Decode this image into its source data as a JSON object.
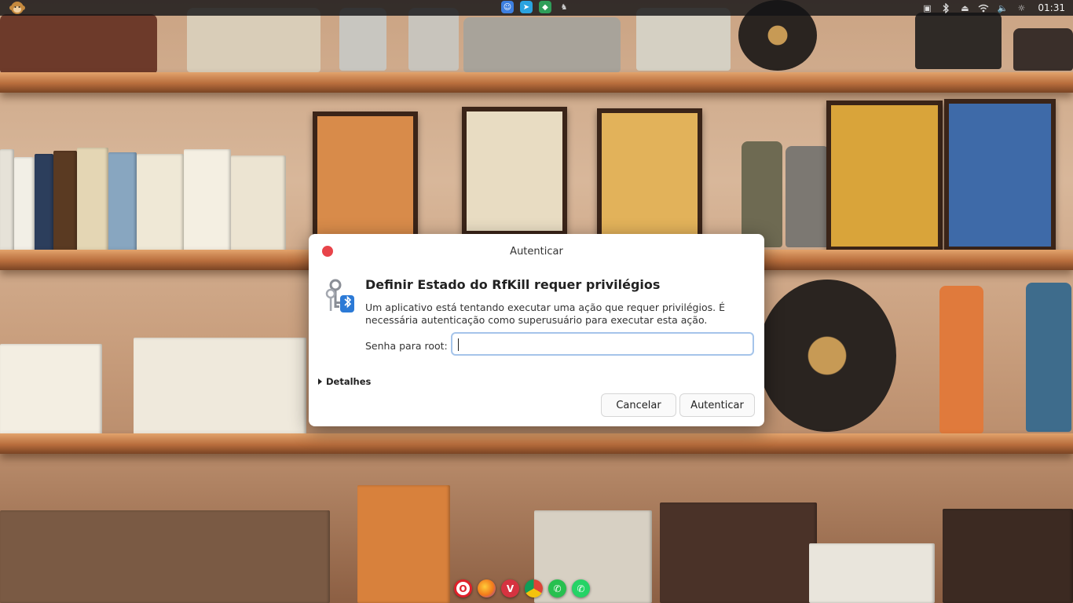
{
  "panel": {
    "clock": "01:31",
    "center_apps": [
      {
        "icon": "finder-face-icon",
        "color": "#3d7fe0"
      },
      {
        "icon": "telegram-icon",
        "color": "#2aa3e0"
      },
      {
        "icon": "shield-vpn-icon",
        "color": "#2f9e59"
      },
      {
        "icon": "ghost-icon",
        "color": "#7a7a7a"
      }
    ]
  },
  "dialog": {
    "title": "Autenticar",
    "heading": "Definir Estado do RfKill requer privilégios",
    "message": "Um aplicativo está tentando executar uma ação que requer privilégios. É necessária autenticação como superusuário para executar esta ação.",
    "password_label": "Senha para root:",
    "password_value": "",
    "details_label": "Detalhes",
    "cancel_label": "Cancelar",
    "authenticate_label": "Autenticar",
    "accent_color": "#a5c4ea",
    "close_color": "#e8444a"
  },
  "dock": {
    "apps": [
      {
        "icon": "opera-icon",
        "glyph": "O",
        "color": "#e0202a"
      },
      {
        "icon": "firefox-icon",
        "glyph": "",
        "color": "#f27a1a"
      },
      {
        "icon": "vivaldi-icon",
        "glyph": "V",
        "color": "#d63340"
      },
      {
        "icon": "chrome-icon",
        "glyph": "",
        "color": "#3e9d47"
      },
      {
        "icon": "whatsapp-icon",
        "glyph": "✆",
        "color": "#27c04f"
      },
      {
        "icon": "whatsapp-icon",
        "glyph": "✆",
        "color": "#25d366"
      }
    ]
  }
}
